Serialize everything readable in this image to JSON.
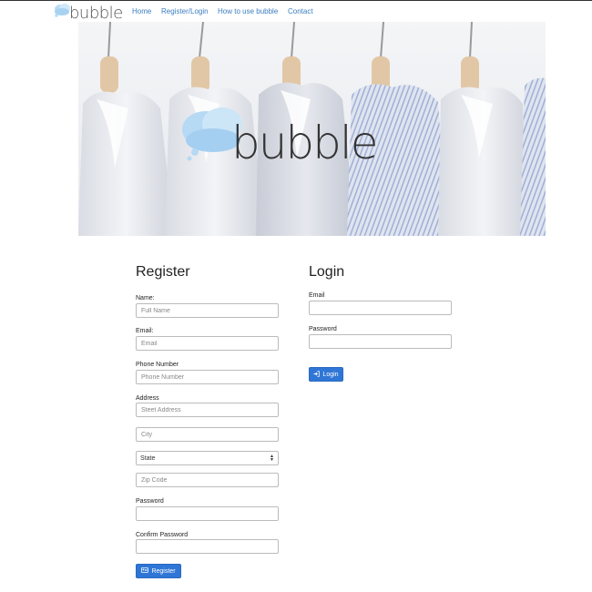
{
  "nav": {
    "logo_text": "bubble",
    "links": [
      {
        "label": "Home"
      },
      {
        "label": "Register/Login"
      },
      {
        "label": "How to use bubble"
      },
      {
        "label": "Contact"
      }
    ]
  },
  "hero": {
    "logo_text": "bubble"
  },
  "register": {
    "title": "Register",
    "name_label": "Name:",
    "name_placeholder": "Full Name",
    "email_label": "Email:",
    "email_placeholder": "Email",
    "phone_label": "Phone Number",
    "phone_placeholder": "Phone Number",
    "address_label": "Address",
    "street_placeholder": "Steet Address",
    "city_placeholder": "City",
    "state_selected": "State",
    "zip_placeholder": "Zip Code",
    "password_label": "Password",
    "confirm_label": "Confirm Password",
    "button_label": "Register",
    "button_icon": "id-card-icon"
  },
  "login": {
    "title": "Login",
    "email_label": "Email",
    "password_label": "Password",
    "button_label": "Login",
    "button_icon": "sign-in-icon"
  },
  "colors": {
    "link": "#3a7ec0",
    "button": "#2f76d6"
  }
}
